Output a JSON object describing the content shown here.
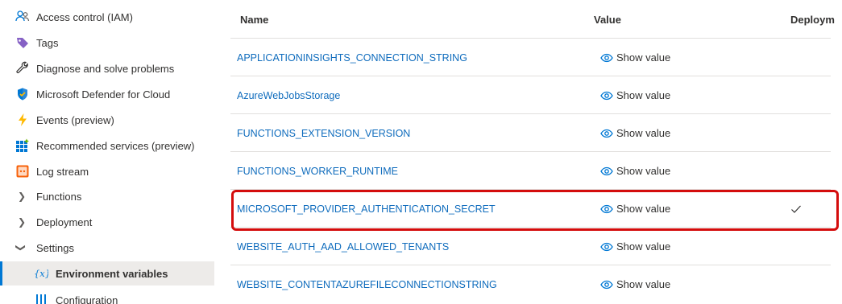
{
  "sidebar": {
    "items": [
      {
        "label": "Access control (IAM)",
        "icon": "people-icon"
      },
      {
        "label": "Tags",
        "icon": "tag-icon"
      },
      {
        "label": "Diagnose and solve problems",
        "icon": "wrench-icon"
      },
      {
        "label": "Microsoft Defender for Cloud",
        "icon": "shield-icon"
      },
      {
        "label": "Events (preview)",
        "icon": "lightning-icon"
      },
      {
        "label": "Recommended services (preview)",
        "icon": "grid-icon"
      },
      {
        "label": "Log stream",
        "icon": "log-stream-icon"
      },
      {
        "label": "Functions",
        "icon": "chevron-right-icon"
      },
      {
        "label": "Deployment",
        "icon": "chevron-right-icon"
      },
      {
        "label": "Settings",
        "icon": "chevron-down-icon"
      },
      {
        "label": "Environment variables",
        "icon": "variable-icon"
      },
      {
        "label": "Configuration",
        "icon": "configuration-icon"
      }
    ]
  },
  "table": {
    "headers": {
      "name": "Name",
      "value": "Value",
      "deployment": "Deploym"
    },
    "show_value_label": "Show value",
    "rows": [
      {
        "name": "APPLICATIONINSIGHTS_CONNECTION_STRING",
        "deployment_slot": false
      },
      {
        "name": "AzureWebJobsStorage",
        "deployment_slot": false
      },
      {
        "name": "FUNCTIONS_EXTENSION_VERSION",
        "deployment_slot": false
      },
      {
        "name": "FUNCTIONS_WORKER_RUNTIME",
        "deployment_slot": false
      },
      {
        "name": "MICROSOFT_PROVIDER_AUTHENTICATION_SECRET",
        "deployment_slot": true
      },
      {
        "name": "WEBSITE_AUTH_AAD_ALLOWED_TENANTS",
        "deployment_slot": false
      },
      {
        "name": "WEBSITE_CONTENTAZUREFILECONNECTIONSTRING",
        "deployment_slot": false
      }
    ]
  },
  "colors": {
    "accent": "#0078d4",
    "link": "#0f6cbd",
    "highlight": "#d40c0c"
  }
}
